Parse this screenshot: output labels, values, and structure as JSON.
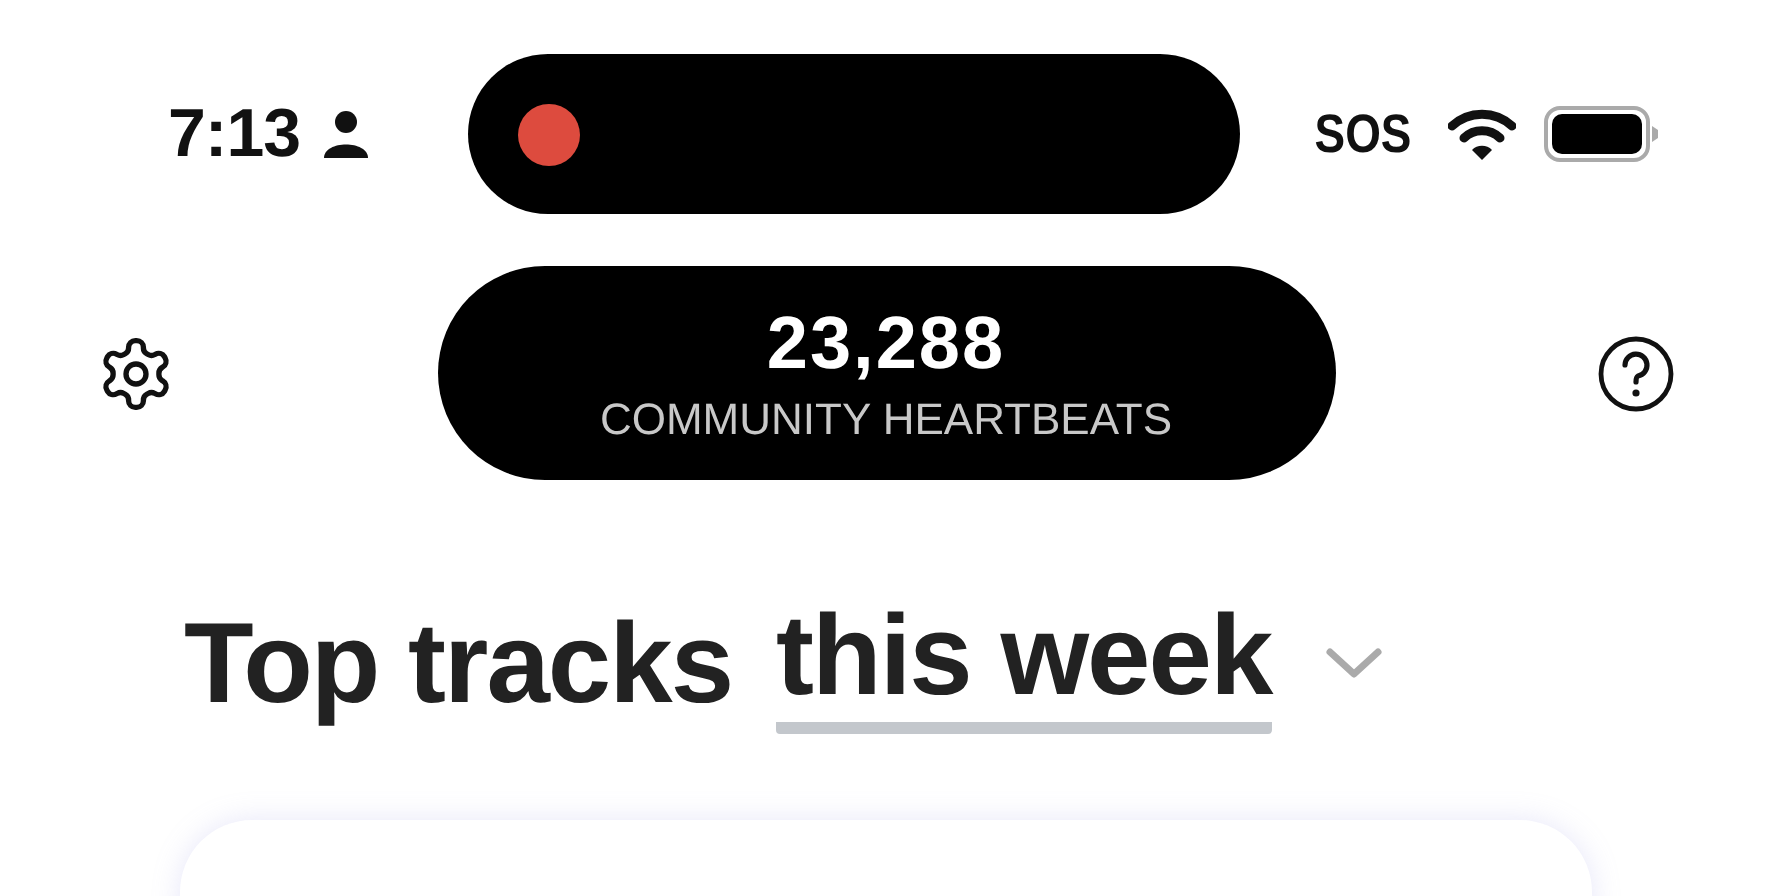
{
  "status_bar": {
    "time": "7:13",
    "sos": "SOS"
  },
  "header": {
    "count": "23,288",
    "count_label": "COMMUNITY HEARTBEATS"
  },
  "heading": {
    "title": "Top tracks",
    "period": "this week"
  }
}
